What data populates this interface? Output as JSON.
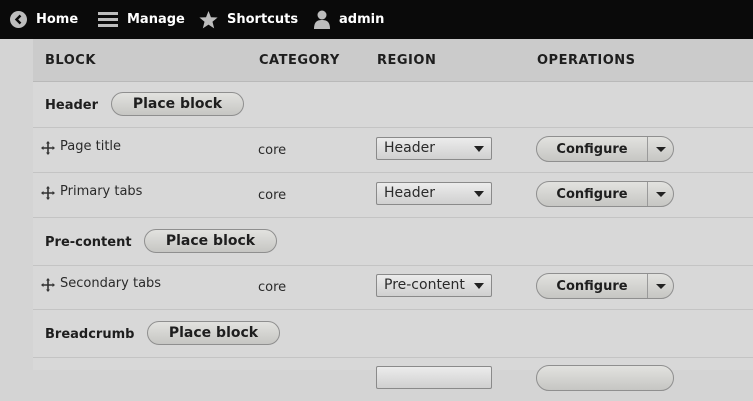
{
  "toolbar": {
    "home": {
      "label": "Home",
      "icon": "chevron-left-circle-icon"
    },
    "manage": {
      "label": "Manage",
      "icon": "hamburger-menu-icon"
    },
    "shortcuts": {
      "label": "Shortcuts",
      "icon": "star-icon"
    },
    "user": {
      "label": "admin",
      "icon": "user-icon"
    }
  },
  "table": {
    "headers": [
      "BLOCK",
      "CATEGORY",
      "REGION",
      "OPERATIONS"
    ],
    "place_block_label": "Place block",
    "regions": [
      {
        "title": "Header",
        "blocks": [
          {
            "name": "Page title",
            "category": "core",
            "region": "Header",
            "operation": "Configure"
          },
          {
            "name": "Primary tabs",
            "category": "core",
            "region": "Header",
            "operation": "Configure"
          }
        ]
      },
      {
        "title": "Pre-content",
        "blocks": [
          {
            "name": "Secondary tabs",
            "category": "core",
            "region": "Pre-content",
            "operation": "Configure"
          }
        ]
      },
      {
        "title": "Breadcrumb",
        "blocks": []
      }
    ]
  },
  "colors": {
    "toolbar_bg": "#0a0a0a",
    "page_bg": "#d4d4d4",
    "button_text": "#1e1e1e"
  }
}
